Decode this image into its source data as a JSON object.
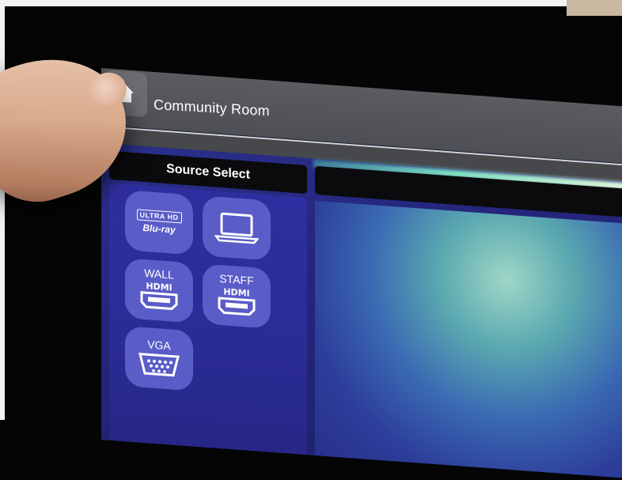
{
  "header": {
    "home_icon": "home-icon",
    "room_title": "Community Room"
  },
  "source_select": {
    "title": "Source Select",
    "sources": [
      {
        "id": "bluray",
        "top": "ULTRA HD",
        "bottom": "Blu-ray",
        "icon": "bluray-icon"
      },
      {
        "id": "laptop",
        "label": "",
        "icon": "laptop-icon"
      },
      {
        "id": "wall-hdmi",
        "label": "WALL",
        "icon": "hdmi-icon"
      },
      {
        "id": "staff-hdmi",
        "label": "STAFF",
        "icon": "hdmi-icon"
      },
      {
        "id": "vga",
        "label": "VGA",
        "icon": "vga-icon"
      }
    ]
  },
  "colors": {
    "header_bg": "#55575c",
    "panel_bg": "#2c2c9a",
    "button_bg": "#5a5cc8",
    "text": "#ffffff"
  }
}
